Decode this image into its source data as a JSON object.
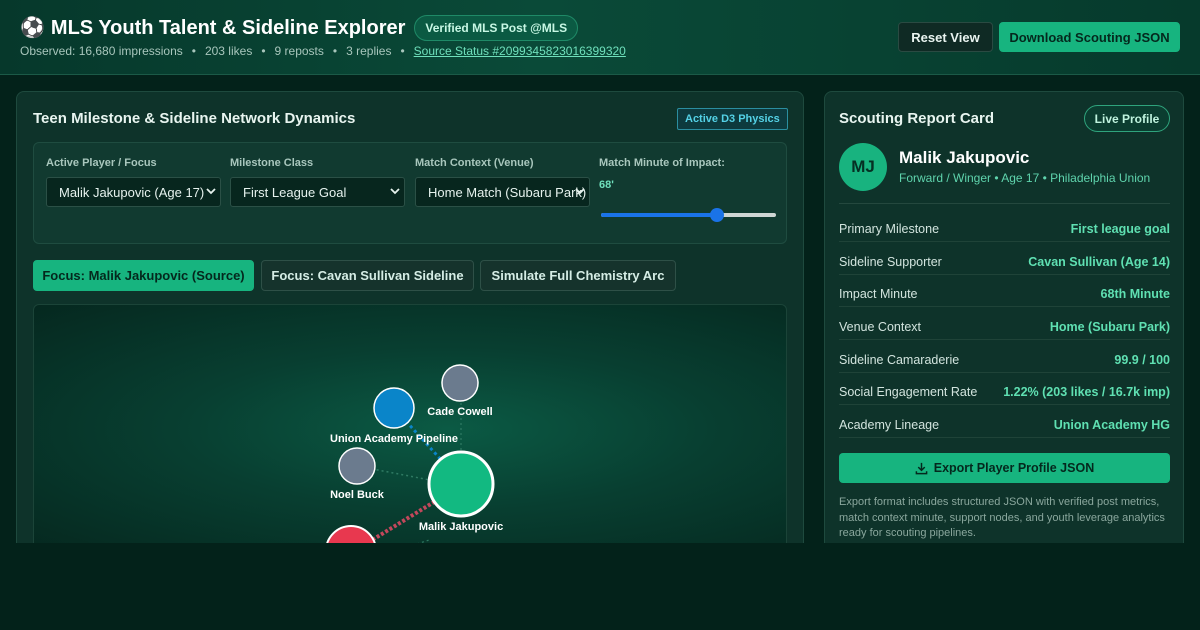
{
  "header": {
    "icon": "soccer-ball-icon",
    "title": "MLS Youth Talent & Sideline Explorer",
    "badge": "Verified MLS Post @MLS",
    "impressions": "Observed: 16,680 impressions",
    "likes": "203 likes",
    "reposts": "9 reposts",
    "replies": "3 replies",
    "separator": "•",
    "source_link": "Source Status #2099345823016399320",
    "reset_label": "Reset View",
    "download_label": "Download Scouting JSON"
  },
  "network": {
    "title": "Teen Milestone & Sideline Network Dynamics",
    "physics_badge": "Active D3 Physics",
    "controls": {
      "player_label": "Active Player / Focus",
      "player_value": "Malik Jakupovic (Age 17)",
      "milestone_label": "Milestone Class",
      "milestone_value": "First League Goal",
      "context_label": "Match Context (Venue)",
      "context_value": "Home Match (Subaru Park)",
      "minute_label": "Match Minute of Impact:",
      "minute_value": "68'",
      "minute_fraction": 0.68
    },
    "focus_buttons": [
      "Focus: Malik Jakupovic (Source)",
      "Focus: Cavan Sullivan Sideline",
      "Simulate Full Chemistry Arc"
    ],
    "nodes": [
      {
        "label": "Cade Cowell",
        "color": "#6b7b8e"
      },
      {
        "label": "Union Academy Pipeline",
        "color": "#0a85c9"
      },
      {
        "label": "Noel Buck",
        "color": "#6b7b8e"
      },
      {
        "label": "Malik Jakupovic",
        "color": "#12b981"
      },
      {
        "label": "",
        "color": "#e8384f"
      }
    ]
  },
  "report": {
    "title": "Scouting Report Card",
    "live_badge": "Live Profile",
    "initials": "MJ",
    "name": "Malik Jakupovic",
    "subtitle": "Forward / Winger • Age 17 • Philadelphia Union",
    "stats": [
      {
        "label": "Primary Milestone",
        "value": "First league goal"
      },
      {
        "label": "Sideline Supporter",
        "value": "Cavan Sullivan (Age 14)"
      },
      {
        "label": "Impact Minute",
        "value": "68th Minute"
      },
      {
        "label": "Venue Context",
        "value": "Home (Subaru Park)"
      },
      {
        "label": "Sideline Camaraderie",
        "value": "99.9 / 100"
      },
      {
        "label": "Social Engagement Rate",
        "value": "1.22% (203 likes / 16.7k imp)"
      },
      {
        "label": "Academy Lineage",
        "value": "Union Academy HG"
      }
    ],
    "export_label": "Export Player Profile JSON",
    "export_icon": "download-icon",
    "export_note": "Export format includes structured JSON with verified post metrics, match context minute, support nodes, and youth leverage analytics ready for scouting pipelines."
  }
}
